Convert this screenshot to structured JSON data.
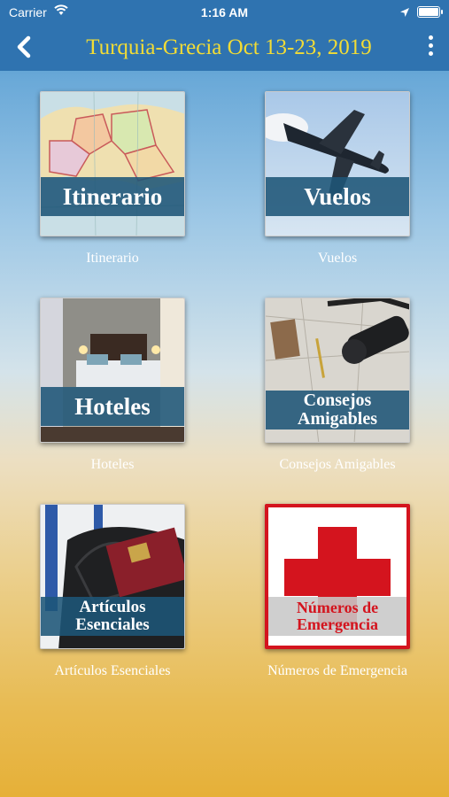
{
  "status_bar": {
    "carrier": "Carrier",
    "time": "1:16 AM",
    "battery_level": 1.0
  },
  "nav": {
    "title": "Turquia-Grecia Oct 13-23, 2019",
    "back_icon": "chevron-left-icon",
    "menu_icon": "more-vertical-icon"
  },
  "tiles": [
    {
      "banner": "Itinerario",
      "caption": "Itinerario",
      "image": "europe-map"
    },
    {
      "banner": "Vuelos",
      "caption": "Vuelos",
      "image": "airplane-sky"
    },
    {
      "banner": "Hoteles",
      "caption": "Hoteles",
      "image": "hotel-room"
    },
    {
      "banner_line1": "Consejos",
      "banner_line2": "Amigables",
      "caption": "Consejos Amigables",
      "image": "travel-map-camera"
    },
    {
      "banner_line1": "Artículos",
      "banner_line2": "Esenciales",
      "caption": "Artículos Esenciales",
      "image": "luggage-passport"
    },
    {
      "banner_line1": "Números de",
      "banner_line2": "Emergencia",
      "caption": "Números de Emergencia",
      "image": "red-cross"
    }
  ],
  "colors": {
    "header": "#2f73b0",
    "title": "#f2dc35",
    "banner": "#1e5578",
    "emergency_text": "#d4141e"
  }
}
